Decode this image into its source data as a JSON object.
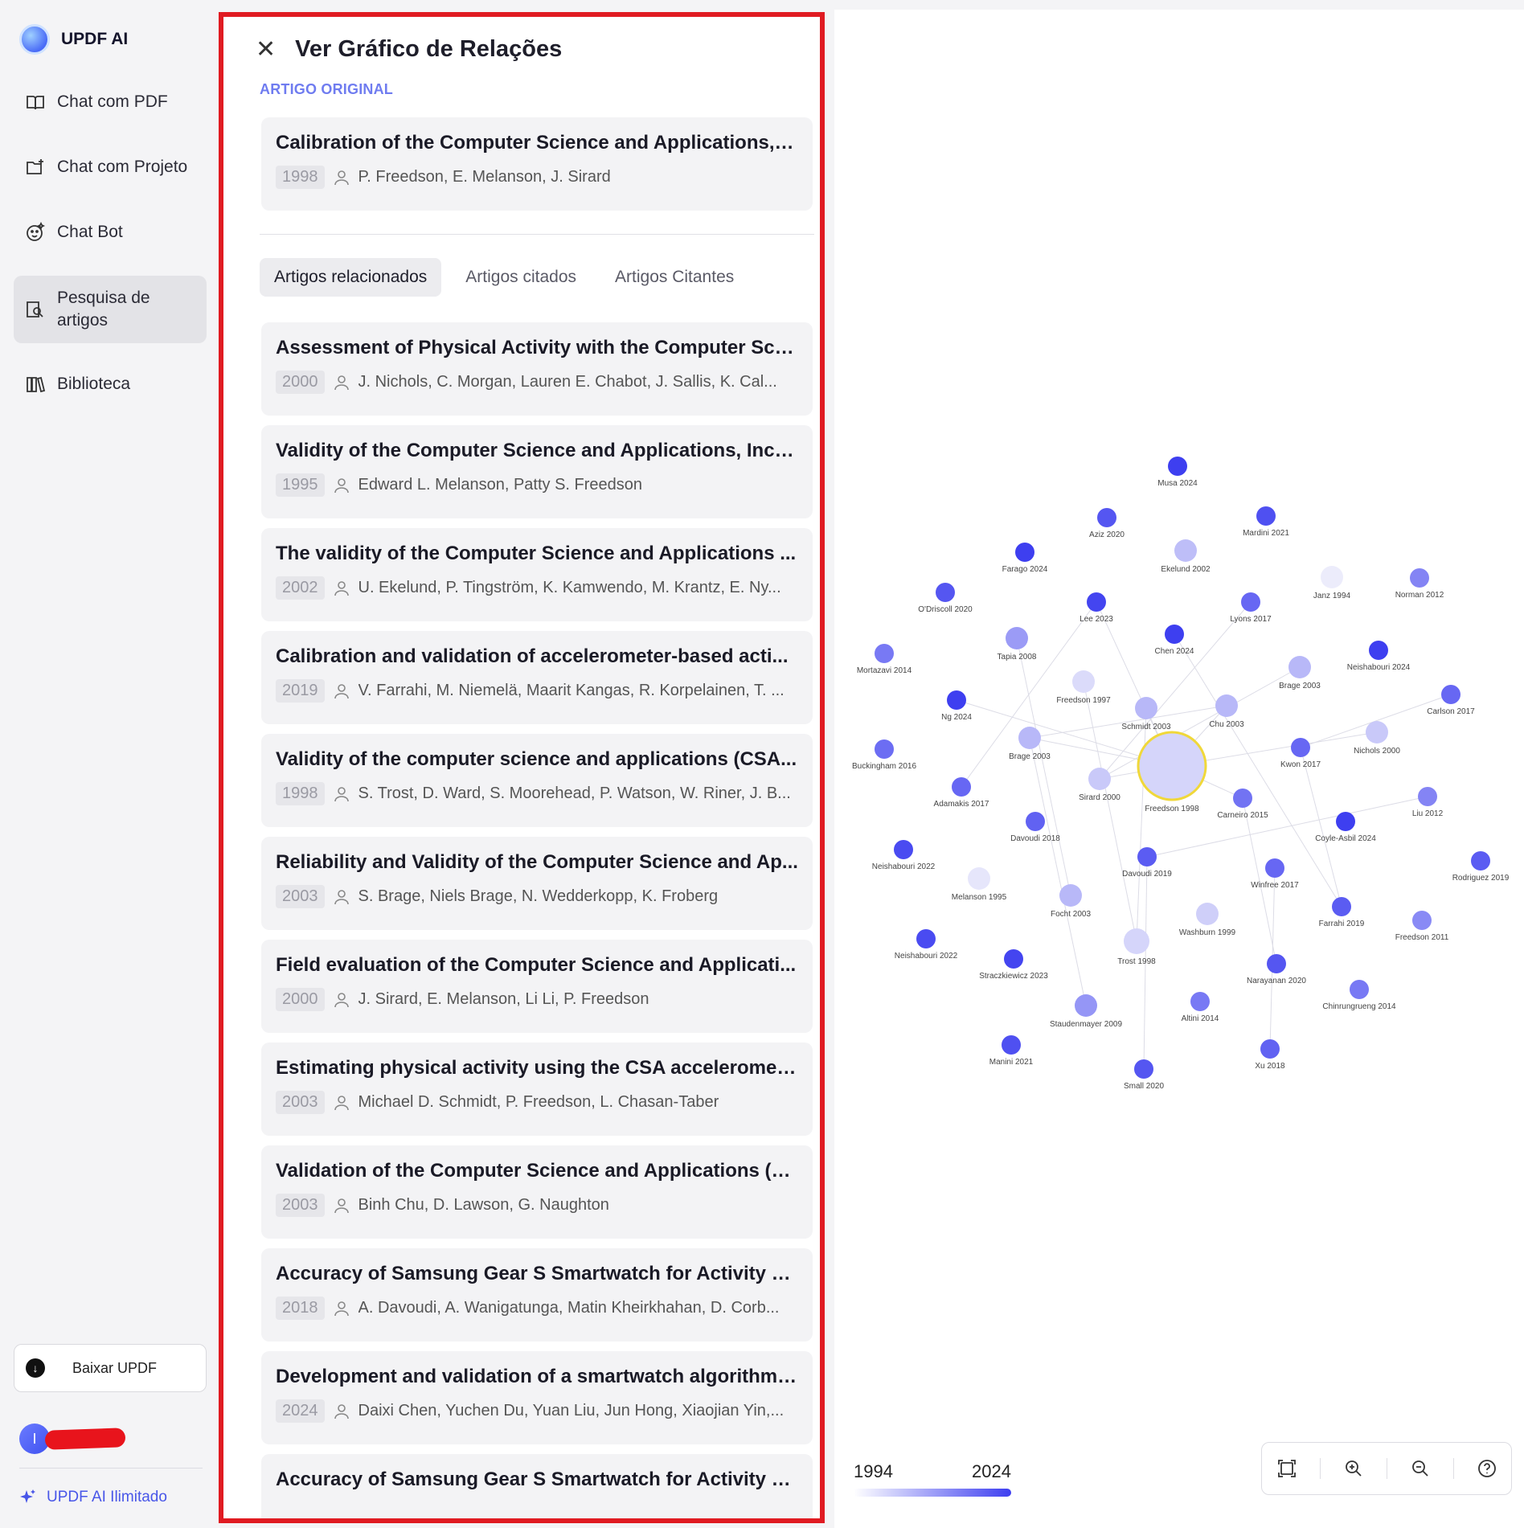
{
  "app": {
    "name": "UPDF AI"
  },
  "sidebar": {
    "items": [
      {
        "label": "Chat com PDF",
        "icon": "book-open-icon"
      },
      {
        "label": "Chat com Projeto",
        "icon": "folder-plus-icon"
      },
      {
        "label": "Chat Bot",
        "icon": "bot-icon"
      },
      {
        "label": "Pesquisa de artigos",
        "icon": "article-search-icon",
        "active": true
      },
      {
        "label": "Biblioteca",
        "icon": "library-icon"
      }
    ],
    "download_label": "Baixar UPDF",
    "user_initial": "I",
    "unlimited_label": "UPDF AI Ilimitado"
  },
  "panel": {
    "title": "Ver Gráfico de Relações",
    "section_label": "ARTIGO ORIGINAL",
    "original": {
      "title": "Calibration of the Computer Science and Applications, I...",
      "year": "1998",
      "authors": "P. Freedson, E. Melanson, J. Sirard"
    },
    "tabs": [
      "Artigos relacionados",
      "Artigos citados",
      "Artigos Citantes"
    ],
    "active_tab": 0,
    "articles": [
      {
        "title": "Assessment of Physical Activity with the Computer Scie...",
        "year": "2000",
        "authors": "J. Nichols, C. Morgan, Lauren E. Chabot, J. Sallis, K. Cal..."
      },
      {
        "title": "Validity of the Computer Science and Applications, Inc. ...",
        "year": "1995",
        "authors": "Edward L. Melanson, Patty S. Freedson"
      },
      {
        "title": "The validity of the Computer Science and Applications ...",
        "year": "2002",
        "authors": "U. Ekelund, P. Tingström, K. Kamwendo, M. Krantz, E. Ny..."
      },
      {
        "title": "Calibration and validation of accelerometer-based acti...",
        "year": "2019",
        "authors": "V. Farrahi, M. Niemelä, Maarit Kangas, R. Korpelainen, T. ..."
      },
      {
        "title": "Validity of the computer science and applications (CSA...",
        "year": "1998",
        "authors": "S. Trost, D. Ward, S. Moorehead, P. Watson, W. Riner, J. B..."
      },
      {
        "title": "Reliability and Validity of the Computer Science and Ap...",
        "year": "2003",
        "authors": "S. Brage, Niels Brage, N. Wedderkopp, K. Froberg"
      },
      {
        "title": "Field evaluation of the Computer Science and Applicati...",
        "year": "2000",
        "authors": "J. Sirard, E. Melanson, Li Li, P. Freedson"
      },
      {
        "title": "Estimating physical activity using the CSA acceleromet...",
        "year": "2003",
        "authors": "Michael D. Schmidt, P. Freedson, L. Chasan-Taber"
      },
      {
        "title": "Validation of the Computer Science and Applications (C...",
        "year": "2003",
        "authors": "Binh Chu, D. Lawson, G. Naughton"
      },
      {
        "title": "Accuracy of Samsung Gear S Smartwatch for Activity R...",
        "year": "2018",
        "authors": "A. Davoudi, A. Wanigatunga, Matin Kheirkhahan, D. Corb..."
      },
      {
        "title": "Development and validation of a smartwatch algorithm ...",
        "year": "2024",
        "authors": "Daixi Chen, Yuchen Du, Yuan Liu, Jun Hong, Xiaojian Yin,..."
      },
      {
        "title": "Accuracy of Samsung Gear S Smartwatch for Activity R...",
        "year": "",
        "authors": ""
      }
    ]
  },
  "graph": {
    "center": {
      "label": "Freedson 1998",
      "year": 1998
    },
    "nodes": [
      {
        "label": "Musa 2024",
        "year": 2024
      },
      {
        "label": "Aziz 2020",
        "year": 2020
      },
      {
        "label": "Mardini 2021",
        "year": 2021
      },
      {
        "label": "Farago 2024",
        "year": 2024
      },
      {
        "label": "Ekelund 2002",
        "year": 2002
      },
      {
        "label": "Janz 1994",
        "year": 1994
      },
      {
        "label": "Norman 2012",
        "year": 2012
      },
      {
        "label": "O'Driscoll 2020",
        "year": 2020
      },
      {
        "label": "Lee 2023",
        "year": 2023
      },
      {
        "label": "Lyons 2017",
        "year": 2017
      },
      {
        "label": "Tapia 2008",
        "year": 2008
      },
      {
        "label": "Chen 2024",
        "year": 2024
      },
      {
        "label": "Mortazavi 2014",
        "year": 2014
      },
      {
        "label": "Neishabouri 2024",
        "year": 2024
      },
      {
        "label": "Brage 2003",
        "year": 2003
      },
      {
        "label": "Freedson 1997",
        "year": 1997
      },
      {
        "label": "Carlson 2017",
        "year": 2017
      },
      {
        "label": "Ng 2024",
        "year": 2024
      },
      {
        "label": "Schmidt 2003",
        "year": 2003
      },
      {
        "label": "Chu 2003",
        "year": 2003
      },
      {
        "label": "Brage 2003",
        "year": 2003
      },
      {
        "label": "Nichols 2000",
        "year": 2000
      },
      {
        "label": "Buckingham 2016",
        "year": 2016
      },
      {
        "label": "Kwon 2017",
        "year": 2017
      },
      {
        "label": "Sirard 2000",
        "year": 2000
      },
      {
        "label": "Adamakis 2017",
        "year": 2017
      },
      {
        "label": "Carneiro 2015",
        "year": 2015
      },
      {
        "label": "Liu 2012",
        "year": 2012
      },
      {
        "label": "Davoudi 2018",
        "year": 2018
      },
      {
        "label": "Coyle-Asbil 2024",
        "year": 2024
      },
      {
        "label": "Neishabouri 2022",
        "year": 2022
      },
      {
        "label": "Davoudi 2019",
        "year": 2019
      },
      {
        "label": "Rodriguez 2019",
        "year": 2019
      },
      {
        "label": "Melanson 1995",
        "year": 1995
      },
      {
        "label": "Winfree 2017",
        "year": 2017
      },
      {
        "label": "Focht 2003",
        "year": 2003
      },
      {
        "label": "Farrahi 2019",
        "year": 2019
      },
      {
        "label": "Washburn 1999",
        "year": 1999
      },
      {
        "label": "Freedson 2011",
        "year": 2011
      },
      {
        "label": "Neishabouri 2022",
        "year": 2022
      },
      {
        "label": "Trost 1998",
        "year": 1998
      },
      {
        "label": "Straczkiewicz 2023",
        "year": 2023
      },
      {
        "label": "Narayanan 2020",
        "year": 2020
      },
      {
        "label": "Chinrungrueng 2014",
        "year": 2014
      },
      {
        "label": "Staudenmayer 2009",
        "year": 2009
      },
      {
        "label": "Altini 2014",
        "year": 2014
      },
      {
        "label": "Manini 2021",
        "year": 2021
      },
      {
        "label": "Xu 2018",
        "year": 2018
      },
      {
        "label": "Small 2020",
        "year": 2020
      }
    ],
    "legend": {
      "min_year": "1994",
      "max_year": "2024"
    },
    "colors": {
      "new": "#3e3ff0",
      "old": "#ececfb",
      "center_ring": "#f0d83a"
    }
  }
}
